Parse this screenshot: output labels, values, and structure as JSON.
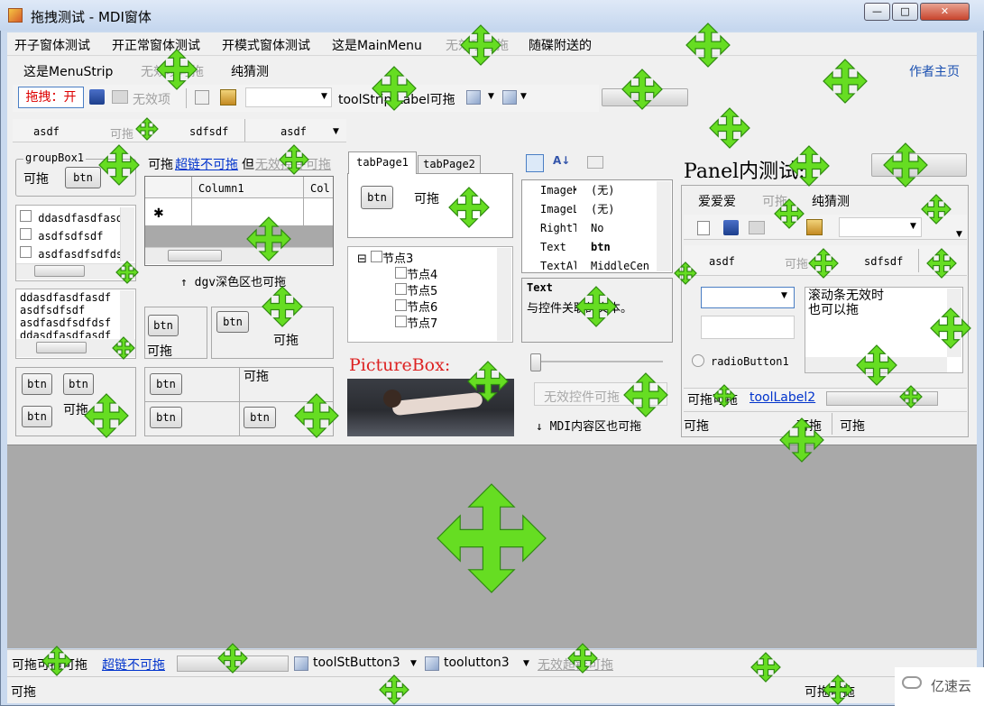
{
  "window": {
    "title": "拖拽测试 - MDI窗体",
    "btn_min": "—",
    "btn_max": "□",
    "btn_close": "✕"
  },
  "menu": {
    "items": [
      "开子窗体测试",
      "开正常窗体测试",
      "开模式窗体测试",
      "这是MainMenu",
      "无效项可拖",
      "随碟附送的"
    ]
  },
  "menustrip": {
    "items": [
      "这是MenuStrip",
      "无效项可拖",
      "纯猜测"
    ],
    "author": "作者主页"
  },
  "toolstrip": {
    "drag_btn": "拖拽：开",
    "disabled": "无效项",
    "label": "toolStrip Label可拖"
  },
  "tabstrip": {
    "items": [
      "asdf",
      "可拖",
      "sdfsdf",
      "asdf"
    ]
  },
  "group": {
    "title": "groupBox1",
    "can_drag": "可拖",
    "btn": "btn"
  },
  "link_line": {
    "prefix": "可拖",
    "link": "超链不可拖",
    "mid": "但",
    "disabled": "无效控件可拖"
  },
  "grid": {
    "col1": "Column1",
    "col2": "Col",
    "new_row": "✱",
    "caption": "↑ dgv深色区也可拖"
  },
  "listbox1": {
    "items": [
      "ddasdfasdfasd",
      "asdfsdfsdf",
      "asdfasdfsdfdsf"
    ]
  },
  "textbox1": {
    "lines": [
      "ddasdfasdfasdf",
      "asdfsdfsdf",
      "asdfasdfsdfdsf",
      "ddasdfasdfasdf"
    ]
  },
  "panels": {
    "btn": "btn",
    "can_drag": "可拖"
  },
  "tabs": {
    "tab1": "tabPage1",
    "tab2": "tabPage2",
    "btn": "btn",
    "can_drag": "可拖"
  },
  "tree": {
    "nodes": [
      "节点3",
      "节点4",
      "节点5",
      "节点6",
      "节点7"
    ]
  },
  "picture": {
    "title": "PictureBox:"
  },
  "props": {
    "rows": [
      [
        "ImageKe",
        "(无)"
      ],
      [
        "ImageLi",
        "(无)"
      ],
      [
        "RightTo",
        "No"
      ],
      [
        "Text",
        "btn"
      ],
      [
        "TextAli",
        "MiddleCen"
      ]
    ],
    "help_title": "Text",
    "help_text": "与控件关联的文本。"
  },
  "mid_bottom": {
    "disabled_box": "无效控件可拖",
    "caption": "↓ MDI内容区也可拖"
  },
  "panel": {
    "title": "Panel内测试:",
    "menu": [
      "爱爱爱",
      "可拖",
      "纯猜测"
    ],
    "tabs": [
      "asdf",
      "可拖",
      "sdfsdf"
    ],
    "textbox": "滚动条无效时\n也可以拖",
    "radio": "radioButton1",
    "status_label": "可拖可拖",
    "status_link": "toolLabel2",
    "foot1": "可拖",
    "foot2": "可拖",
    "foot3": "可拖"
  },
  "bottom_strip": {
    "label": "可拖可拖可拖",
    "link": "超链不可拖",
    "btn1": "toolStButton3",
    "btn2": "toolutton3",
    "disabled": "无效超链可拖"
  },
  "status": {
    "left": "可拖",
    "right": "可拖可拖"
  },
  "watermark": "亿速云",
  "accent": {
    "move_icon": "#66dd22",
    "link": "#0033cc",
    "red": "#dd0000"
  }
}
